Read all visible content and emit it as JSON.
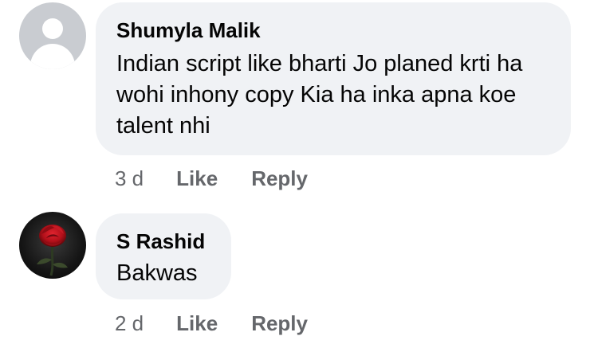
{
  "comments": [
    {
      "author": "Shumyla Malik",
      "text": "Indian script like bharti Jo planed krti ha wohi inhony copy Kia ha inka apna koe talent nhi",
      "time": "3 d",
      "like_label": "Like",
      "reply_label": "Reply",
      "avatar_icon": "default-profile-icon"
    },
    {
      "author": "S Rashid",
      "text": "Bakwas",
      "time": "2 d",
      "like_label": "Like",
      "reply_label": "Reply",
      "avatar_icon": "red-rose-icon"
    }
  ],
  "colors": {
    "bubble_bg": "#f0f2f5",
    "text": "#050505",
    "secondary_text": "#65676b"
  }
}
